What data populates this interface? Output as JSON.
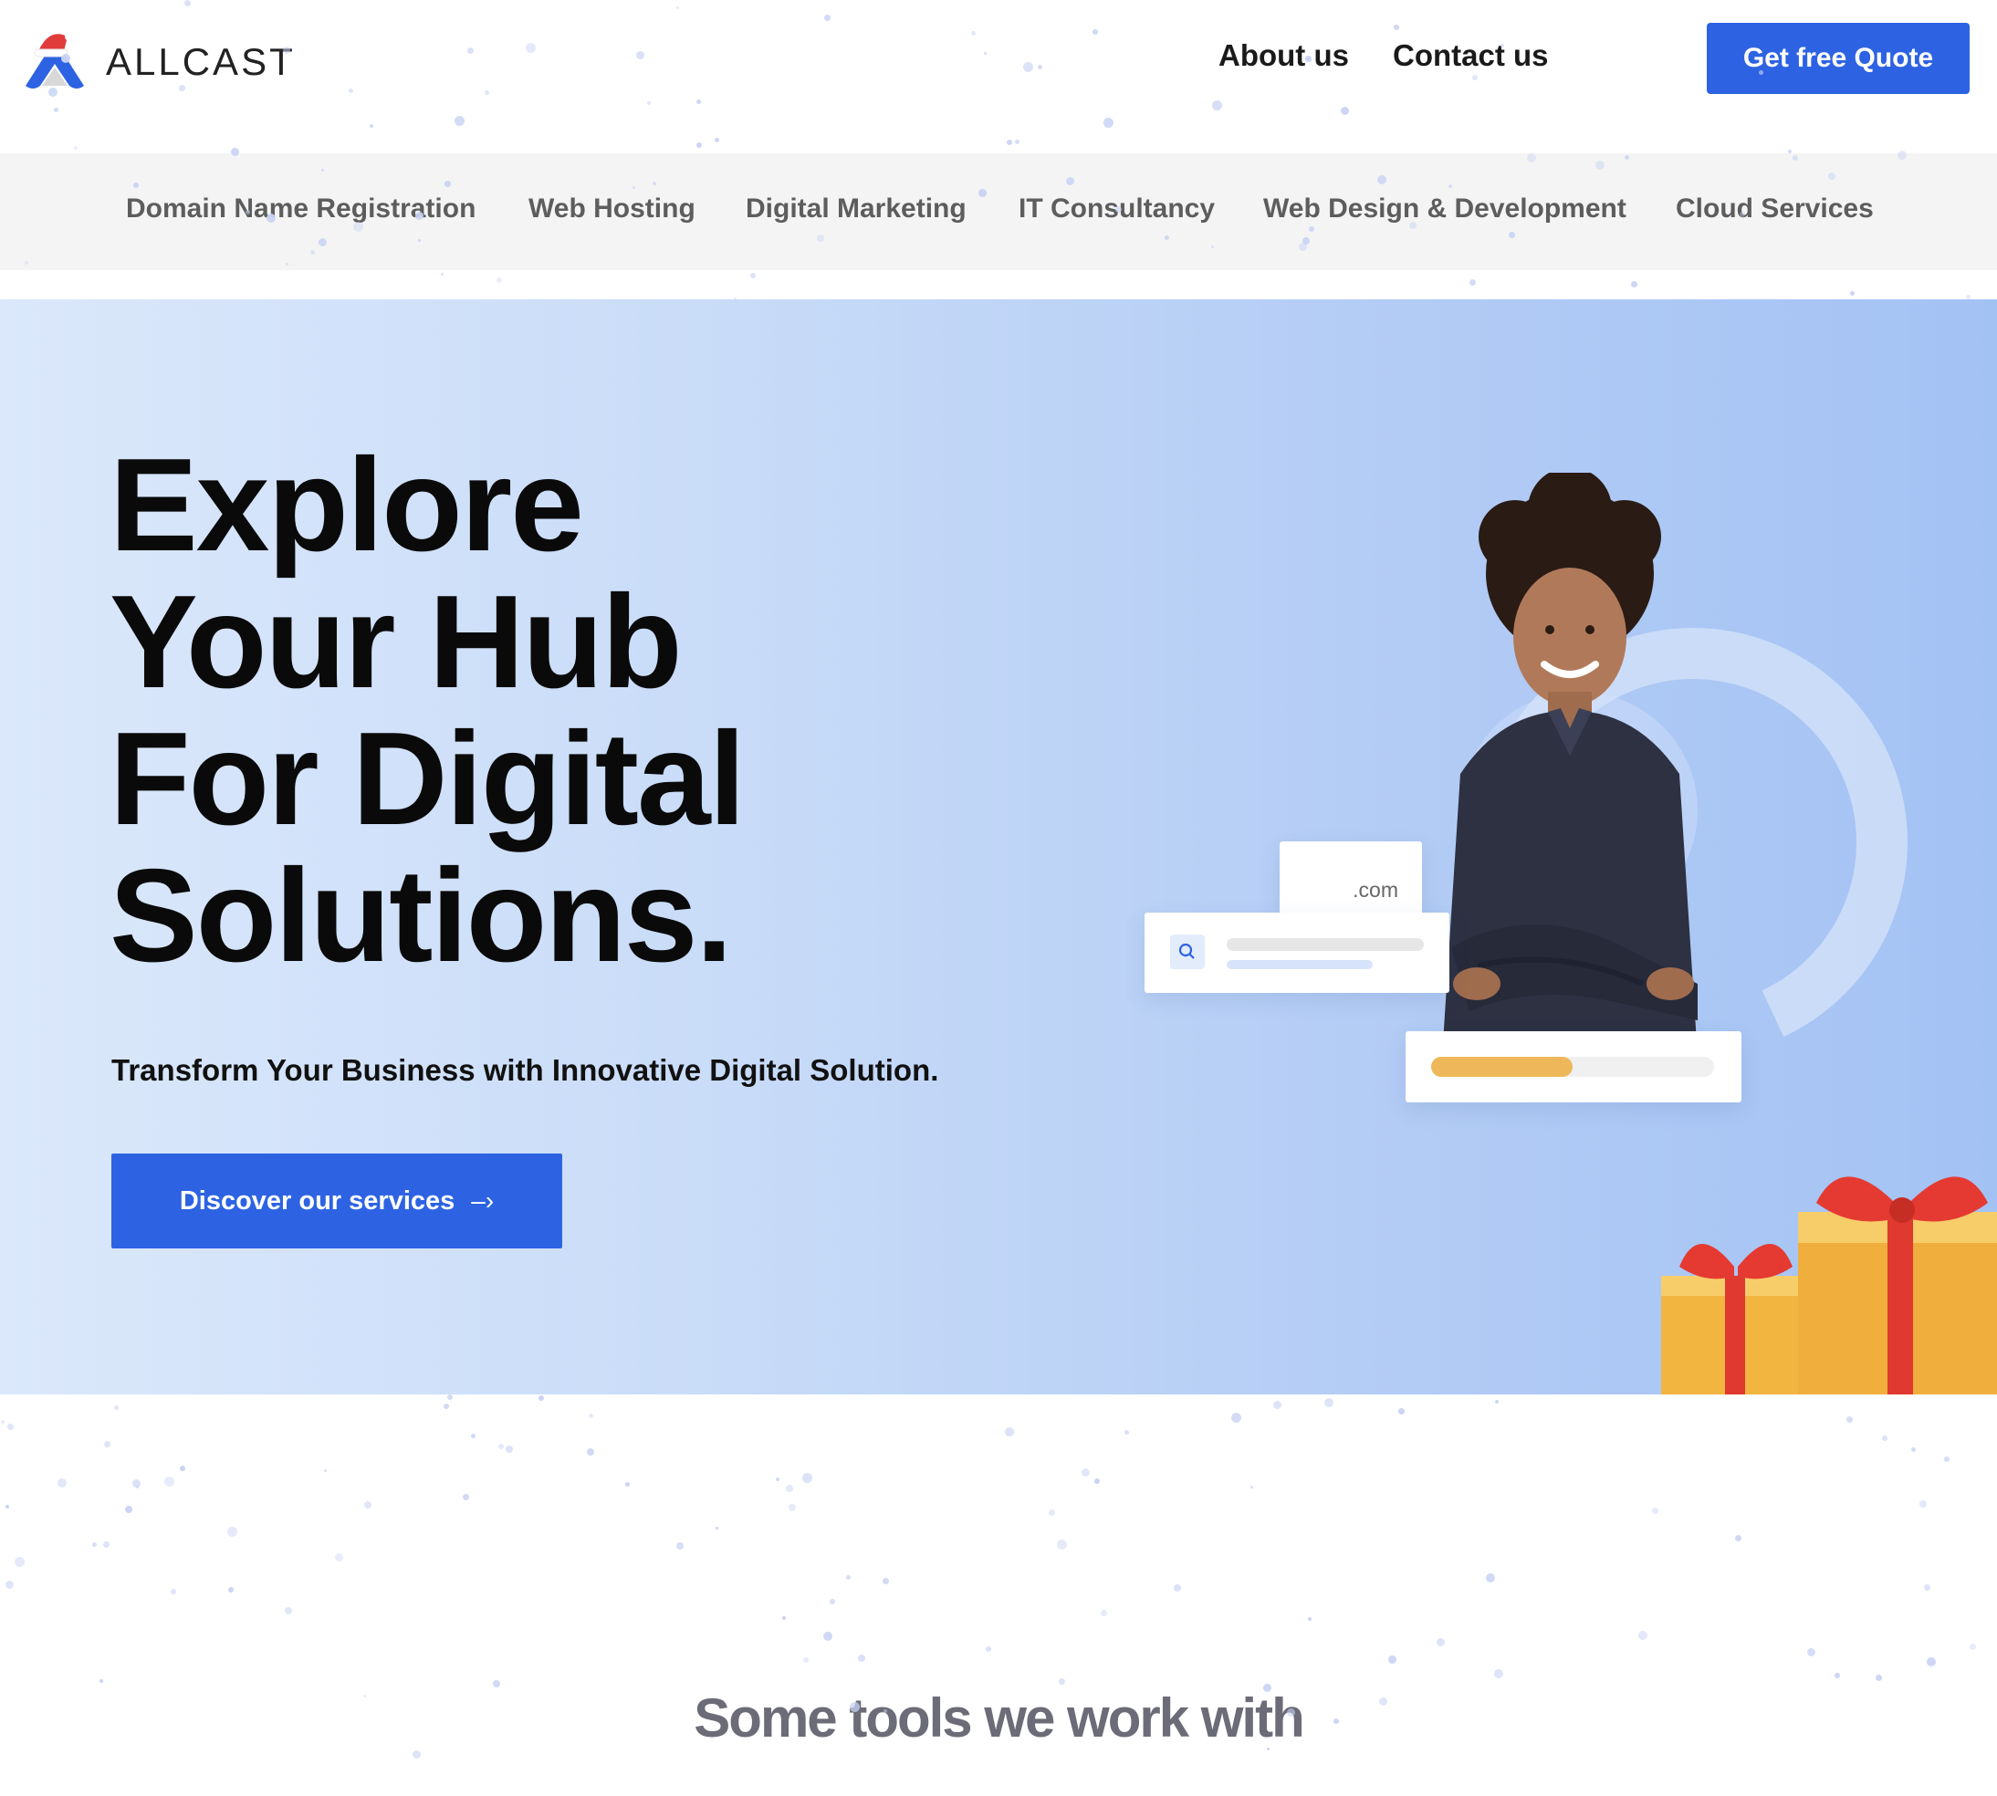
{
  "brand": {
    "name": "ALLCAST",
    "logo_icon": "mountain-with-santa-hat-icon"
  },
  "header": {
    "nav": [
      {
        "label": "About us"
      },
      {
        "label": "Contact us"
      }
    ],
    "quote_button": "Get free Quote"
  },
  "services": [
    "Domain Name Registration",
    "Web Hosting",
    "Digital Marketing",
    "IT Consultancy",
    "Web Design & Development",
    "Cloud Services"
  ],
  "hero": {
    "title_lines": [
      "Explore",
      "Your Hub",
      "For Digital",
      "Solutions."
    ],
    "subtitle": "Transform Your Business with Innovative Digital Solution.",
    "cta_label": "Discover our services",
    "cta_icon": "arrow-right-icon",
    "illustration": {
      "domain_card_text": ".com",
      "search_icon": "search-icon",
      "progress_fraction": 0.5
    },
    "decorations": [
      "gift-boxes"
    ]
  },
  "tools": {
    "heading": "Some tools we work with"
  },
  "colors": {
    "accent": "#2d63e3",
    "hero_gradient_start": "#dbe8fb",
    "hero_gradient_end": "#a3c2f4",
    "progress": "#eeb85a",
    "services_bar": "#f4f4f4"
  }
}
